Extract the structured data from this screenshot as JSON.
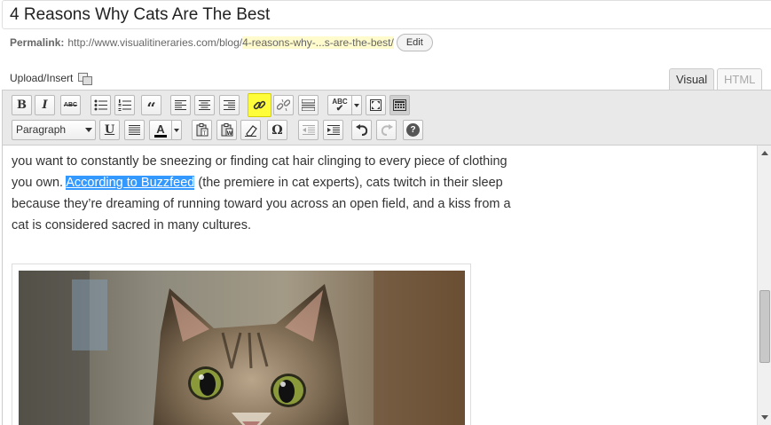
{
  "post": {
    "title": "4 Reasons Why Cats Are The Best"
  },
  "permalink": {
    "label": "Permalink:",
    "base": "http://www.visualitineraries.com/blog/",
    "slug": "4-reasons-why-...s-are-the-best/",
    "edit_label": "Edit"
  },
  "media": {
    "upload_label": "Upload/Insert"
  },
  "tabs": {
    "visual": "Visual",
    "html": "HTML"
  },
  "toolbar": {
    "bold": "B",
    "italic": "I",
    "strike": "ABC",
    "quote": "“",
    "spell": "ABC",
    "underline": "U",
    "text_color": "A",
    "special_char": "Ω",
    "help": "?",
    "format_value": "Paragraph"
  },
  "content": {
    "line1": "you want to constantly be sneezing or finding cat hair clinging to every piece of clothing",
    "line2_before": "you own. ",
    "link_text": "According to Buzzfeed",
    "line2_after": " (the premiere in cat experts), cats twitch in their sleep",
    "line3": "because they’re dreaming of running toward you across an open field, and a kiss from a",
    "line4": "cat is considered sacred in many cultures."
  },
  "colors": {
    "highlight": "#fffc3a",
    "selection": "#3399ff"
  }
}
